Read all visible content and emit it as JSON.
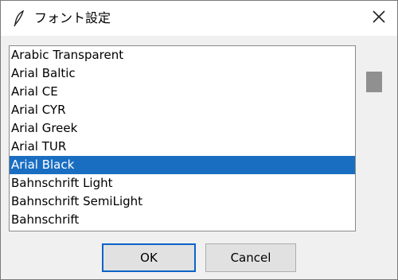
{
  "window": {
    "title": "フォント設定",
    "app_icon": "feather-icon",
    "close_icon": "close-icon"
  },
  "font_list": {
    "items": [
      {
        "label": "Arabic Transparent",
        "selected": false
      },
      {
        "label": "Arial Baltic",
        "selected": false
      },
      {
        "label": "Arial CE",
        "selected": false
      },
      {
        "label": "Arial CYR",
        "selected": false
      },
      {
        "label": "Arial Greek",
        "selected": false
      },
      {
        "label": "Arial TUR",
        "selected": false
      },
      {
        "label": "Arial Black",
        "selected": true
      },
      {
        "label": "Bahnschrift Light",
        "selected": false
      },
      {
        "label": "Bahnschrift SemiLight",
        "selected": false
      },
      {
        "label": "Bahnschrift",
        "selected": false
      }
    ],
    "selection_color": "#1a6ec2"
  },
  "buttons": {
    "ok_label": "OK",
    "cancel_label": "Cancel"
  }
}
